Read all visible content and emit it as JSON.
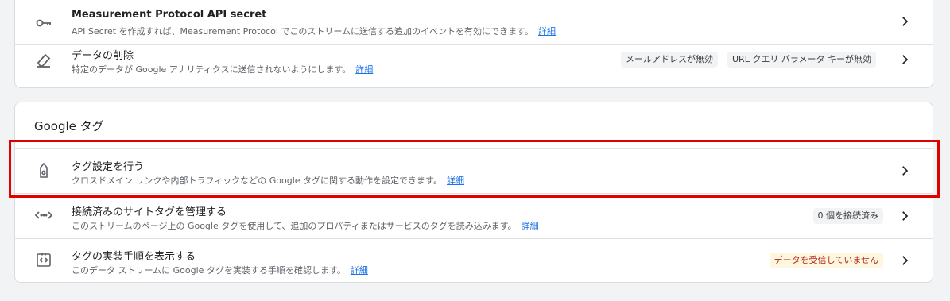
{
  "data_streams": {
    "rows": [
      {
        "title": "Measurement Protocol API secret",
        "description": "API Secret を作成すれば、Measurement Protocol でこのストリームに送信する追加のイベントを有効にできます。",
        "link": "詳細",
        "icon": "key-icon"
      },
      {
        "title": "データの削除",
        "description": "特定のデータが Google アナリティクスに送信されないようにします。",
        "link": "詳細",
        "icon": "eraser-icon",
        "chips": [
          "メールアドレスが無効",
          "URL クエリ パラメータ キーが無効"
        ]
      }
    ]
  },
  "google_tag": {
    "title": "Google タグ",
    "rows": [
      {
        "title": "タグ設定を行う",
        "description": "クロスドメイン リンクや内部トラフィックなどの Google タグに関する動作を設定できます。",
        "link": "詳細",
        "icon": "google-tag-icon"
      },
      {
        "title": "接続済みのサイトタグを管理する",
        "description": "このストリームのページ上の Google タグを使用して、追加のプロパティまたはサービスのタグを読み込みます。",
        "link": "詳細",
        "icon": "code-arrows-icon",
        "chip": "0 個を接続済み"
      },
      {
        "title": "タグの実装手順を表示する",
        "description": "このデータ ストリームに Google タグを実装する手順を確認します。",
        "link": "詳細",
        "icon": "tag-code-icon",
        "chip": "データを受信していません"
      }
    ]
  },
  "colors": {
    "highlight_border": "#e00000",
    "link": "#1a73e8",
    "warning_text": "#b3261e",
    "warning_bg": "#fef7e0"
  }
}
